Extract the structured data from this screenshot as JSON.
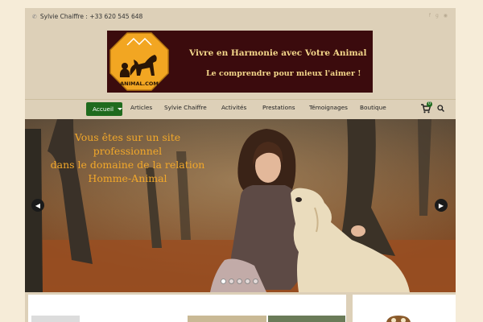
{
  "topbar": {
    "contact": "Sylvie Chaiffre : +33 620 545 648",
    "phone_icon": "phone-icon",
    "social_icons": [
      "facebook-icon",
      "google-plus-icon",
      "rss-icon"
    ]
  },
  "banner": {
    "logo_text": "ANIMAL.COM",
    "line1": "Vivre en Harmonie avec Votre Animal",
    "line2": "Le comprendre pour mieux l'aimer !",
    "colors": {
      "background": "#3b0b0d",
      "text": "#f3d68a",
      "logo": "#f2a622"
    }
  },
  "nav": {
    "active": "Accueil",
    "items": [
      "Articles",
      "Sylvie Chaiffre",
      "Activités",
      "Prestations",
      "Témoignages",
      "Boutique"
    ],
    "cart_count": "0",
    "accent": "#1f6b1e"
  },
  "slider": {
    "caption": [
      "Vous êtes sur un site",
      "professionnel",
      "dans le domaine de la relation",
      "Homme-Animal"
    ],
    "caption_color": "#f2a82a",
    "slide_count": 5,
    "active_slide": 0
  }
}
